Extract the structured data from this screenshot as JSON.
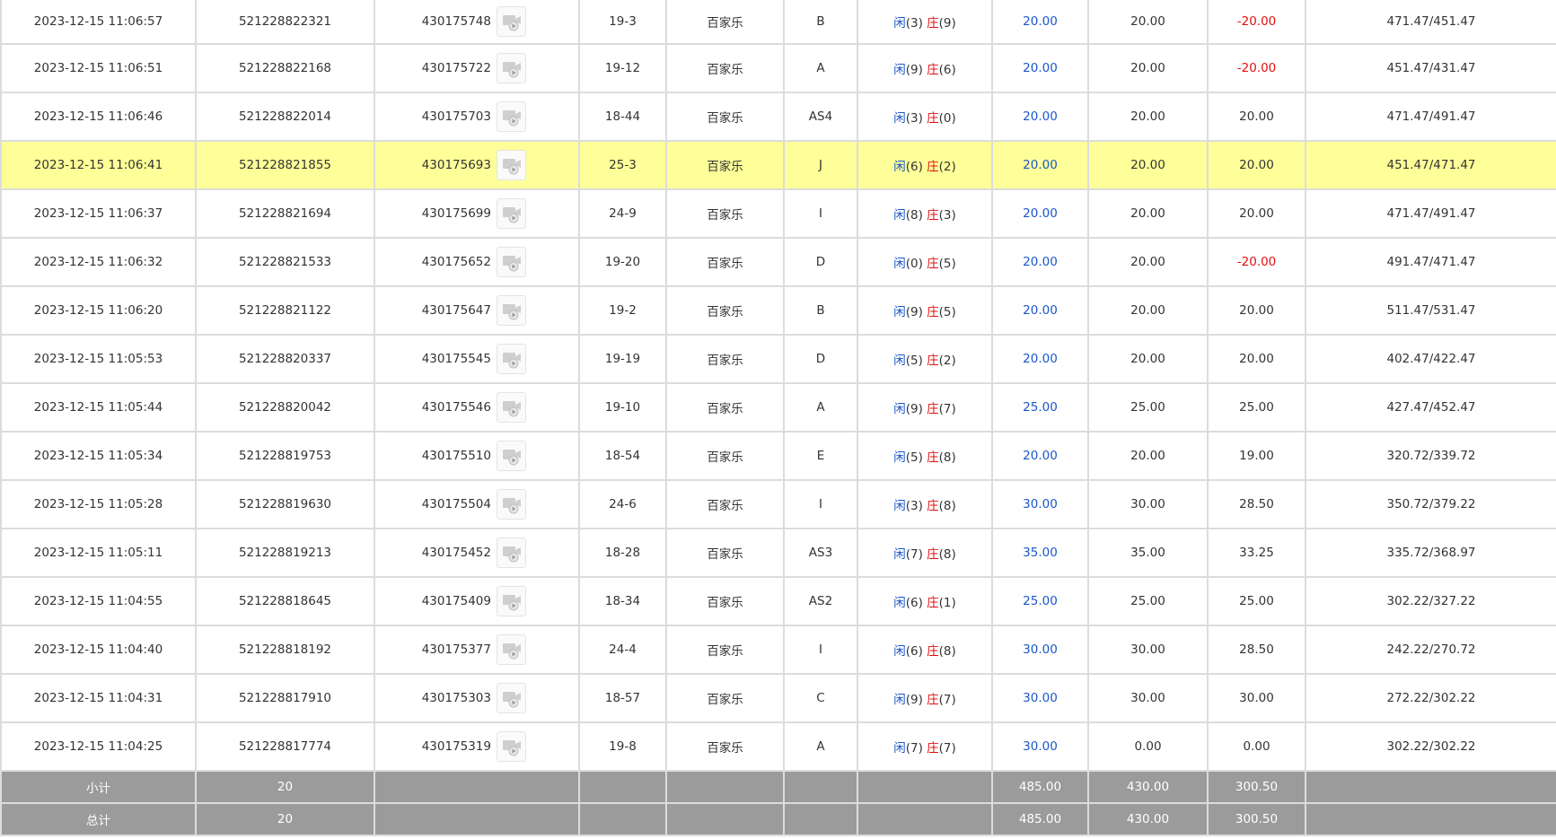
{
  "rows": [
    {
      "time": "2023-12-15 11:06:57",
      "order_no": "521228822321",
      "round_no": "430175748",
      "table": "19-3",
      "game": "百家乐",
      "seat": "B",
      "player_label": "闲",
      "player_score": "(3)",
      "banker_label": "庄",
      "banker_score": "(9)",
      "bet": "20.00",
      "valid": "20.00",
      "win": "-20.00",
      "win_negative": true,
      "balance": "471.47/451.47",
      "highlight": false
    },
    {
      "time": "2023-12-15 11:06:51",
      "order_no": "521228822168",
      "round_no": "430175722",
      "table": "19-12",
      "game": "百家乐",
      "seat": "A",
      "player_label": "闲",
      "player_score": "(9)",
      "banker_label": "庄",
      "banker_score": "(6)",
      "bet": "20.00",
      "valid": "20.00",
      "win": "-20.00",
      "win_negative": true,
      "balance": "451.47/431.47",
      "highlight": false
    },
    {
      "time": "2023-12-15 11:06:46",
      "order_no": "521228822014",
      "round_no": "430175703",
      "table": "18-44",
      "game": "百家乐",
      "seat": "AS4",
      "player_label": "闲",
      "player_score": "(3)",
      "banker_label": "庄",
      "banker_score": "(0)",
      "bet": "20.00",
      "valid": "20.00",
      "win": "20.00",
      "win_negative": false,
      "balance": "471.47/491.47",
      "highlight": false
    },
    {
      "time": "2023-12-15 11:06:41",
      "order_no": "521228821855",
      "round_no": "430175693",
      "table": "25-3",
      "game": "百家乐",
      "seat": "J",
      "player_label": "闲",
      "player_score": "(6)",
      "banker_label": "庄",
      "banker_score": "(2)",
      "bet": "20.00",
      "valid": "20.00",
      "win": "20.00",
      "win_negative": false,
      "balance": "451.47/471.47",
      "highlight": true
    },
    {
      "time": "2023-12-15 11:06:37",
      "order_no": "521228821694",
      "round_no": "430175699",
      "table": "24-9",
      "game": "百家乐",
      "seat": "I",
      "player_label": "闲",
      "player_score": "(8)",
      "banker_label": "庄",
      "banker_score": "(3)",
      "bet": "20.00",
      "valid": "20.00",
      "win": "20.00",
      "win_negative": false,
      "balance": "471.47/491.47",
      "highlight": false
    },
    {
      "time": "2023-12-15 11:06:32",
      "order_no": "521228821533",
      "round_no": "430175652",
      "table": "19-20",
      "game": "百家乐",
      "seat": "D",
      "player_label": "闲",
      "player_score": "(0)",
      "banker_label": "庄",
      "banker_score": "(5)",
      "bet": "20.00",
      "valid": "20.00",
      "win": "-20.00",
      "win_negative": true,
      "balance": "491.47/471.47",
      "highlight": false
    },
    {
      "time": "2023-12-15 11:06:20",
      "order_no": "521228821122",
      "round_no": "430175647",
      "table": "19-2",
      "game": "百家乐",
      "seat": "B",
      "player_label": "闲",
      "player_score": "(9)",
      "banker_label": "庄",
      "banker_score": "(5)",
      "bet": "20.00",
      "valid": "20.00",
      "win": "20.00",
      "win_negative": false,
      "balance": "511.47/531.47",
      "highlight": false
    },
    {
      "time": "2023-12-15 11:05:53",
      "order_no": "521228820337",
      "round_no": "430175545",
      "table": "19-19",
      "game": "百家乐",
      "seat": "D",
      "player_label": "闲",
      "player_score": "(5)",
      "banker_label": "庄",
      "banker_score": "(2)",
      "bet": "20.00",
      "valid": "20.00",
      "win": "20.00",
      "win_negative": false,
      "balance": "402.47/422.47",
      "highlight": false
    },
    {
      "time": "2023-12-15 11:05:44",
      "order_no": "521228820042",
      "round_no": "430175546",
      "table": "19-10",
      "game": "百家乐",
      "seat": "A",
      "player_label": "闲",
      "player_score": "(9)",
      "banker_label": "庄",
      "banker_score": "(7)",
      "bet": "25.00",
      "valid": "25.00",
      "win": "25.00",
      "win_negative": false,
      "balance": "427.47/452.47",
      "highlight": false
    },
    {
      "time": "2023-12-15 11:05:34",
      "order_no": "521228819753",
      "round_no": "430175510",
      "table": "18-54",
      "game": "百家乐",
      "seat": "E",
      "player_label": "闲",
      "player_score": "(5)",
      "banker_label": "庄",
      "banker_score": "(8)",
      "bet": "20.00",
      "valid": "20.00",
      "win": "19.00",
      "win_negative": false,
      "balance": "320.72/339.72",
      "highlight": false
    },
    {
      "time": "2023-12-15 11:05:28",
      "order_no": "521228819630",
      "round_no": "430175504",
      "table": "24-6",
      "game": "百家乐",
      "seat": "I",
      "player_label": "闲",
      "player_score": "(3)",
      "banker_label": "庄",
      "banker_score": "(8)",
      "bet": "30.00",
      "valid": "30.00",
      "win": "28.50",
      "win_negative": false,
      "balance": "350.72/379.22",
      "highlight": false
    },
    {
      "time": "2023-12-15 11:05:11",
      "order_no": "521228819213",
      "round_no": "430175452",
      "table": "18-28",
      "game": "百家乐",
      "seat": "AS3",
      "player_label": "闲",
      "player_score": "(7)",
      "banker_label": "庄",
      "banker_score": "(8)",
      "bet": "35.00",
      "valid": "35.00",
      "win": "33.25",
      "win_negative": false,
      "balance": "335.72/368.97",
      "highlight": false
    },
    {
      "time": "2023-12-15 11:04:55",
      "order_no": "521228818645",
      "round_no": "430175409",
      "table": "18-34",
      "game": "百家乐",
      "seat": "AS2",
      "player_label": "闲",
      "player_score": "(6)",
      "banker_label": "庄",
      "banker_score": "(1)",
      "bet": "25.00",
      "valid": "25.00",
      "win": "25.00",
      "win_negative": false,
      "balance": "302.22/327.22",
      "highlight": false
    },
    {
      "time": "2023-12-15 11:04:40",
      "order_no": "521228818192",
      "round_no": "430175377",
      "table": "24-4",
      "game": "百家乐",
      "seat": "I",
      "player_label": "闲",
      "player_score": "(6)",
      "banker_label": "庄",
      "banker_score": "(8)",
      "bet": "30.00",
      "valid": "30.00",
      "win": "28.50",
      "win_negative": false,
      "balance": "242.22/270.72",
      "highlight": false
    },
    {
      "time": "2023-12-15 11:04:31",
      "order_no": "521228817910",
      "round_no": "430175303",
      "table": "18-57",
      "game": "百家乐",
      "seat": "C",
      "player_label": "闲",
      "player_score": "(9)",
      "banker_label": "庄",
      "banker_score": "(7)",
      "bet": "30.00",
      "valid": "30.00",
      "win": "30.00",
      "win_negative": false,
      "balance": "272.22/302.22",
      "highlight": false
    },
    {
      "time": "2023-12-15 11:04:25",
      "order_no": "521228817774",
      "round_no": "430175319",
      "table": "19-8",
      "game": "百家乐",
      "seat": "A",
      "player_label": "闲",
      "player_score": "(7)",
      "banker_label": "庄",
      "banker_score": "(7)",
      "bet": "30.00",
      "valid": "0.00",
      "win": "0.00",
      "win_negative": false,
      "balance": "302.22/302.22",
      "highlight": false
    }
  ],
  "subtotal": {
    "label": "小计",
    "count": "20",
    "bet": "485.00",
    "valid": "430.00",
    "win": "300.50"
  },
  "total": {
    "label": "总计",
    "count": "20",
    "bet": "485.00",
    "valid": "430.00",
    "win": "300.50"
  },
  "icons": {
    "replay": "video-replay-icon"
  },
  "colors": {
    "highlight_row": "#ffff99",
    "bet_blue": "#1a57c9",
    "negative_red": "#e01010",
    "total_row_bg": "#9b9b9b"
  }
}
